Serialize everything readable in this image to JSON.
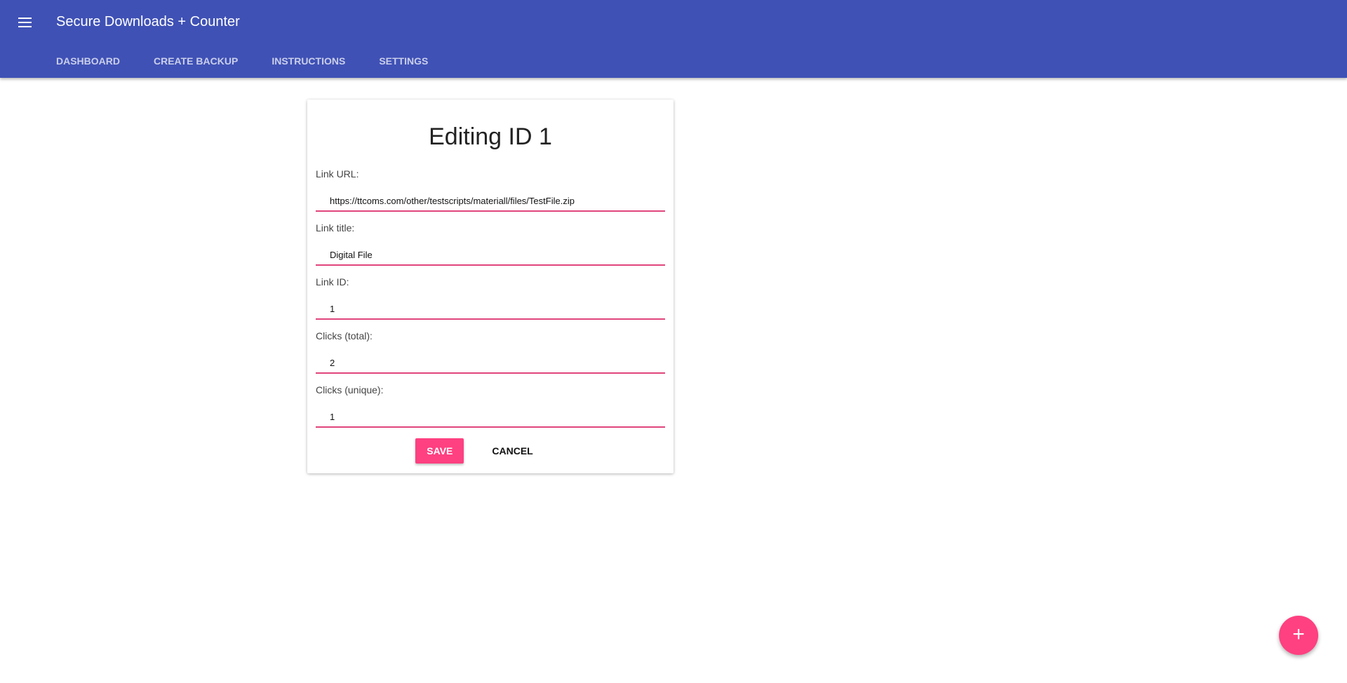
{
  "app": {
    "title": "Secure Downloads + Counter"
  },
  "tabs": [
    {
      "label": "DASHBOARD"
    },
    {
      "label": "CREATE BACKUP"
    },
    {
      "label": "INSTRUCTIONS"
    },
    {
      "label": "SETTINGS"
    }
  ],
  "form": {
    "heading": "Editing ID 1",
    "fields": [
      {
        "label": "Link URL:",
        "value": "https://ttcoms.com/other/testscripts/materiall/files/TestFile.zip"
      },
      {
        "label": "Link title:",
        "value": "Digital File"
      },
      {
        "label": "Link ID:",
        "value": "1"
      },
      {
        "label": "Clicks (total):",
        "value": "2"
      },
      {
        "label": "Clicks (unique):",
        "value": "1"
      }
    ],
    "save_label": "SAVE",
    "cancel_label": "CANCEL"
  },
  "fab": {
    "symbol": "+"
  },
  "colors": {
    "primary": "#3f51b5",
    "accent": "#ff4081"
  }
}
